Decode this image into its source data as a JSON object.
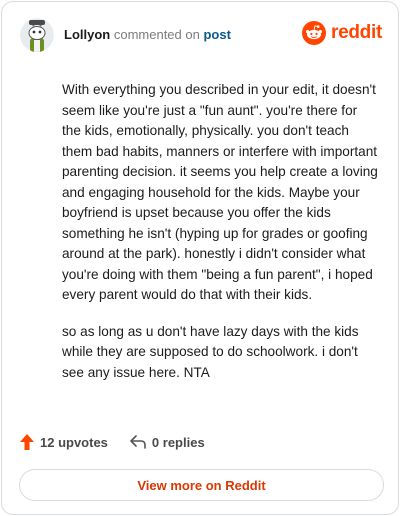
{
  "comment": {
    "author": "Lollyon",
    "action": "commented on",
    "post_link": "post",
    "paragraphs": [
      "With everything you described in your edit, it doesn't seem like you're just a \"fun aunt\". you're there for the kids, emotionally, physically. you don't teach them bad habits, manners or interfere with important parenting decision. it seems you help create a loving and engaging household for the kids. Maybe your boyfriend is upset because you offer the kids something he isn't (hyping up for grades or goofing around at the park). honestly i didn't consider what you're doing with them \"being a fun parent\", i hoped every parent would do that with their kids.",
      "so as long as u don't have lazy days with the kids while they are supposed to do schoolwork. i don't see any issue here. NTA"
    ]
  },
  "brand": {
    "wordmark": "reddit",
    "color": "#ff4500"
  },
  "stats": {
    "upvotes": "12 upvotes",
    "replies": "0 replies"
  },
  "footer": {
    "view_more": "View more on Reddit"
  },
  "icons": {
    "avatar": "snoo-avatar",
    "logo": "reddit-logo-icon",
    "upvote": "upvote-arrow-icon",
    "reply": "reply-arrow-icon"
  }
}
